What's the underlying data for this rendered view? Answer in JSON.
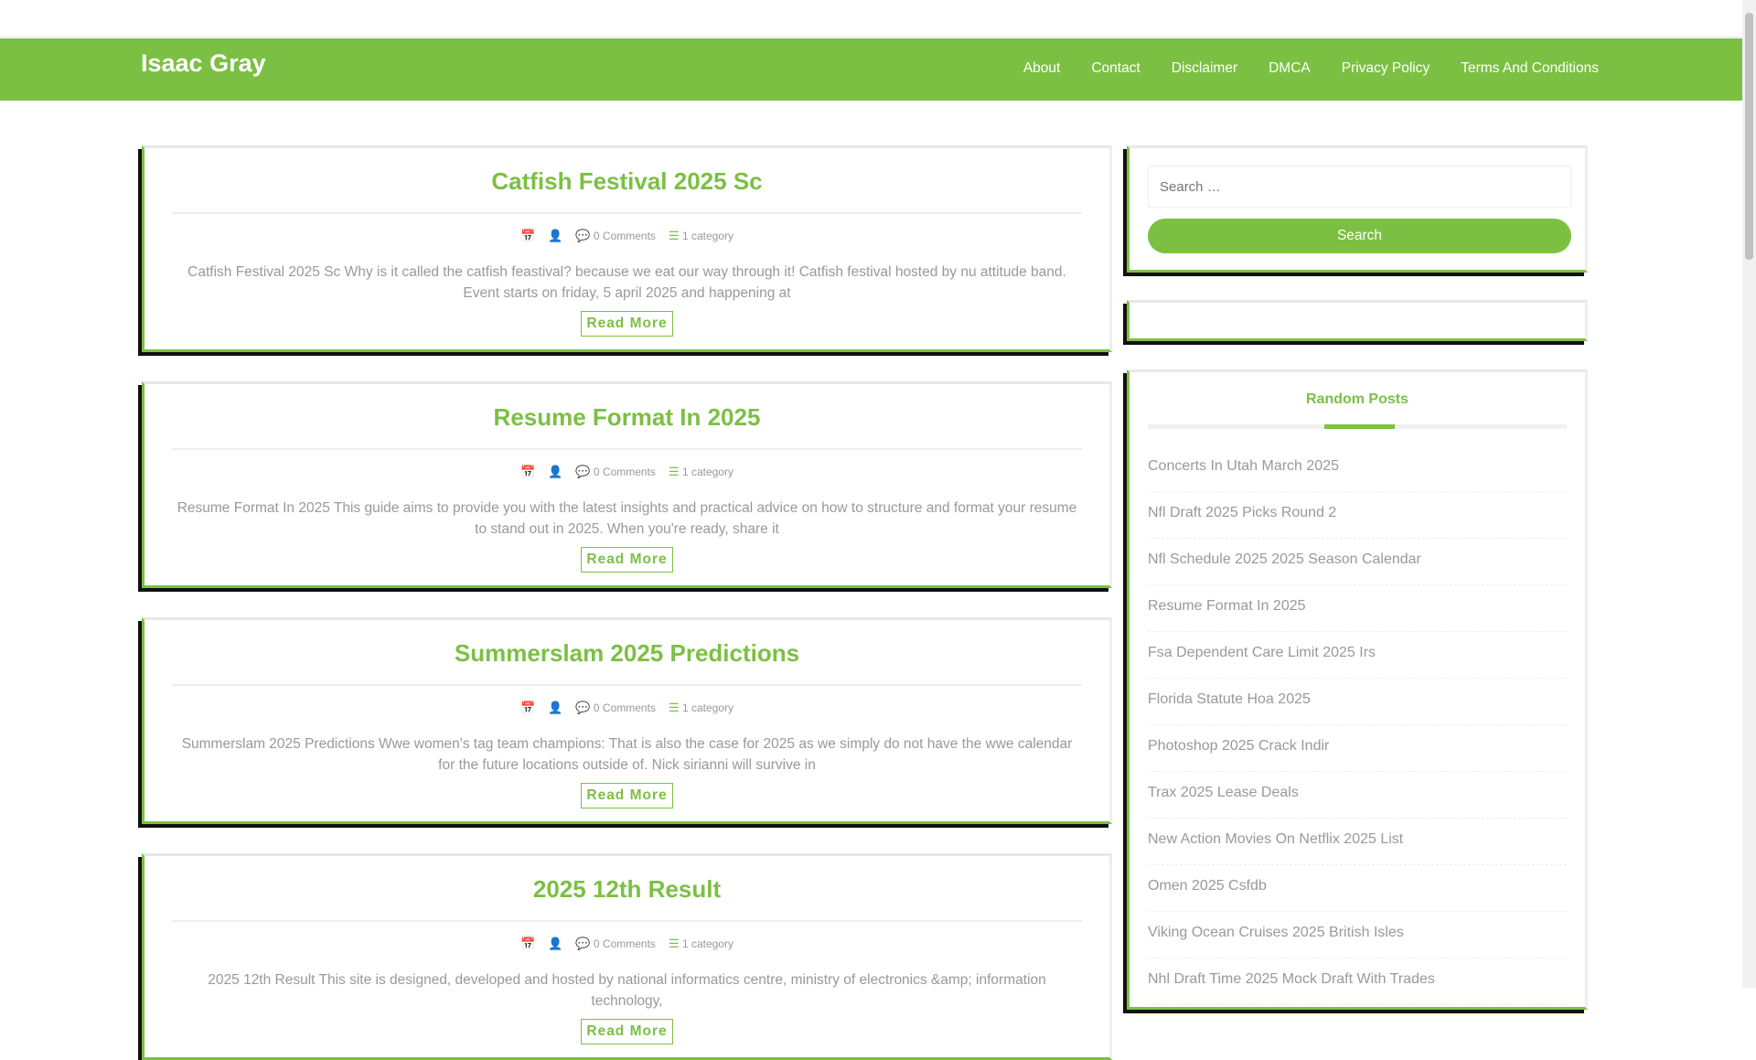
{
  "site": {
    "title": "Isaac Gray"
  },
  "nav": [
    "About",
    "Contact",
    "Disclaimer",
    "DMCA",
    "Privacy Policy",
    "Terms And Conditions"
  ],
  "posts": [
    {
      "title": "Catfish Festival 2025 Sc",
      "comments": "0 Comments",
      "category": "1 category",
      "excerpt": "Catfish Festival 2025 Sc Why is it called the catfish feastival? because we eat our way through it! Catfish festival hosted by nu attitude band. Event starts on friday, 5 april 2025 and happening at",
      "read_more": "Read More"
    },
    {
      "title": "Resume Format In 2025",
      "comments": "0 Comments",
      "category": "1 category",
      "excerpt": "Resume Format In 2025 This guide aims to provide you with the latest insights and practical advice on how to structure and format your resume to stand out in 2025. When you're ready, share it",
      "read_more": "Read More"
    },
    {
      "title": "Summerslam 2025 Predictions",
      "comments": "0 Comments",
      "category": "1 category",
      "excerpt": "Summerslam 2025 Predictions Wwe women's tag team champions: That is also the case for 2025 as we simply do not have the wwe calendar for the future locations outside of. Nick sirianni will survive in",
      "read_more": "Read More"
    },
    {
      "title": "2025 12th Result",
      "comments": "0 Comments",
      "category": "1 category",
      "excerpt": "2025 12th Result This site is designed, developed and hosted by national informatics centre, ministry of electronics &amp; information technology,",
      "read_more": "Read More"
    }
  ],
  "search": {
    "placeholder": "Search …",
    "button": "Search"
  },
  "random_posts": {
    "title": "Random Posts",
    "items": [
      "Concerts In Utah March 2025",
      "Nfl Draft 2025 Picks Round 2",
      "Nfl Schedule 2025 2025 Season Calendar",
      "Resume Format In 2025",
      "Fsa Dependent Care Limit 2025 Irs",
      "Florida Statute Hoa 2025",
      "Photoshop 2025 Crack Indir",
      "Trax 2025 Lease Deals",
      "New Action Movies On Netflix 2025 List",
      "Omen 2025 Csfdb",
      "Viking Ocean Cruises 2025 British Isles",
      "Nhl Draft Time 2025 Mock Draft With Trades"
    ]
  },
  "colors": {
    "accent": "#7bc043"
  }
}
